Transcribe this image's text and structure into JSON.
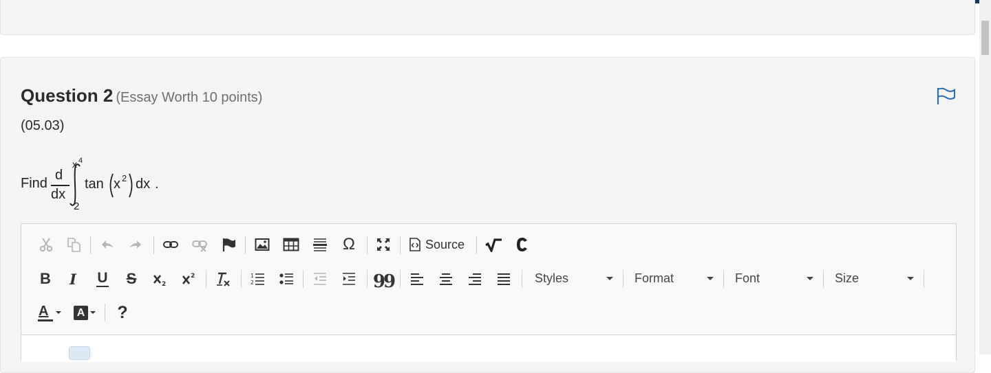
{
  "question": {
    "heading": "Question 2",
    "meta": "(Essay Worth 10 points)",
    "code": "(05.03)"
  },
  "prompt": {
    "lead": "Find",
    "d_num": "d",
    "d_den": "dx",
    "upper_limit": "x",
    "upper_power": "4",
    "lower_limit": "2",
    "integrand": "tan",
    "inner": "x",
    "inner_power": "2",
    "differential": "dx",
    "period": "."
  },
  "toolbar": {
    "source_label": "Source",
    "combos": {
      "styles": "Styles",
      "format": "Format",
      "font": "Font",
      "size": "Size"
    },
    "help_label": "?",
    "bold_label": "B",
    "italic_label": "I",
    "underline_label": "U",
    "strike_label": "S",
    "omega_label": "Ω",
    "quote_label": "99",
    "text_color_label": "A",
    "bg_color_label": "A"
  },
  "colors": {
    "accent_bar": "#0f3d5e",
    "flag_blue": "#2f6db5"
  }
}
